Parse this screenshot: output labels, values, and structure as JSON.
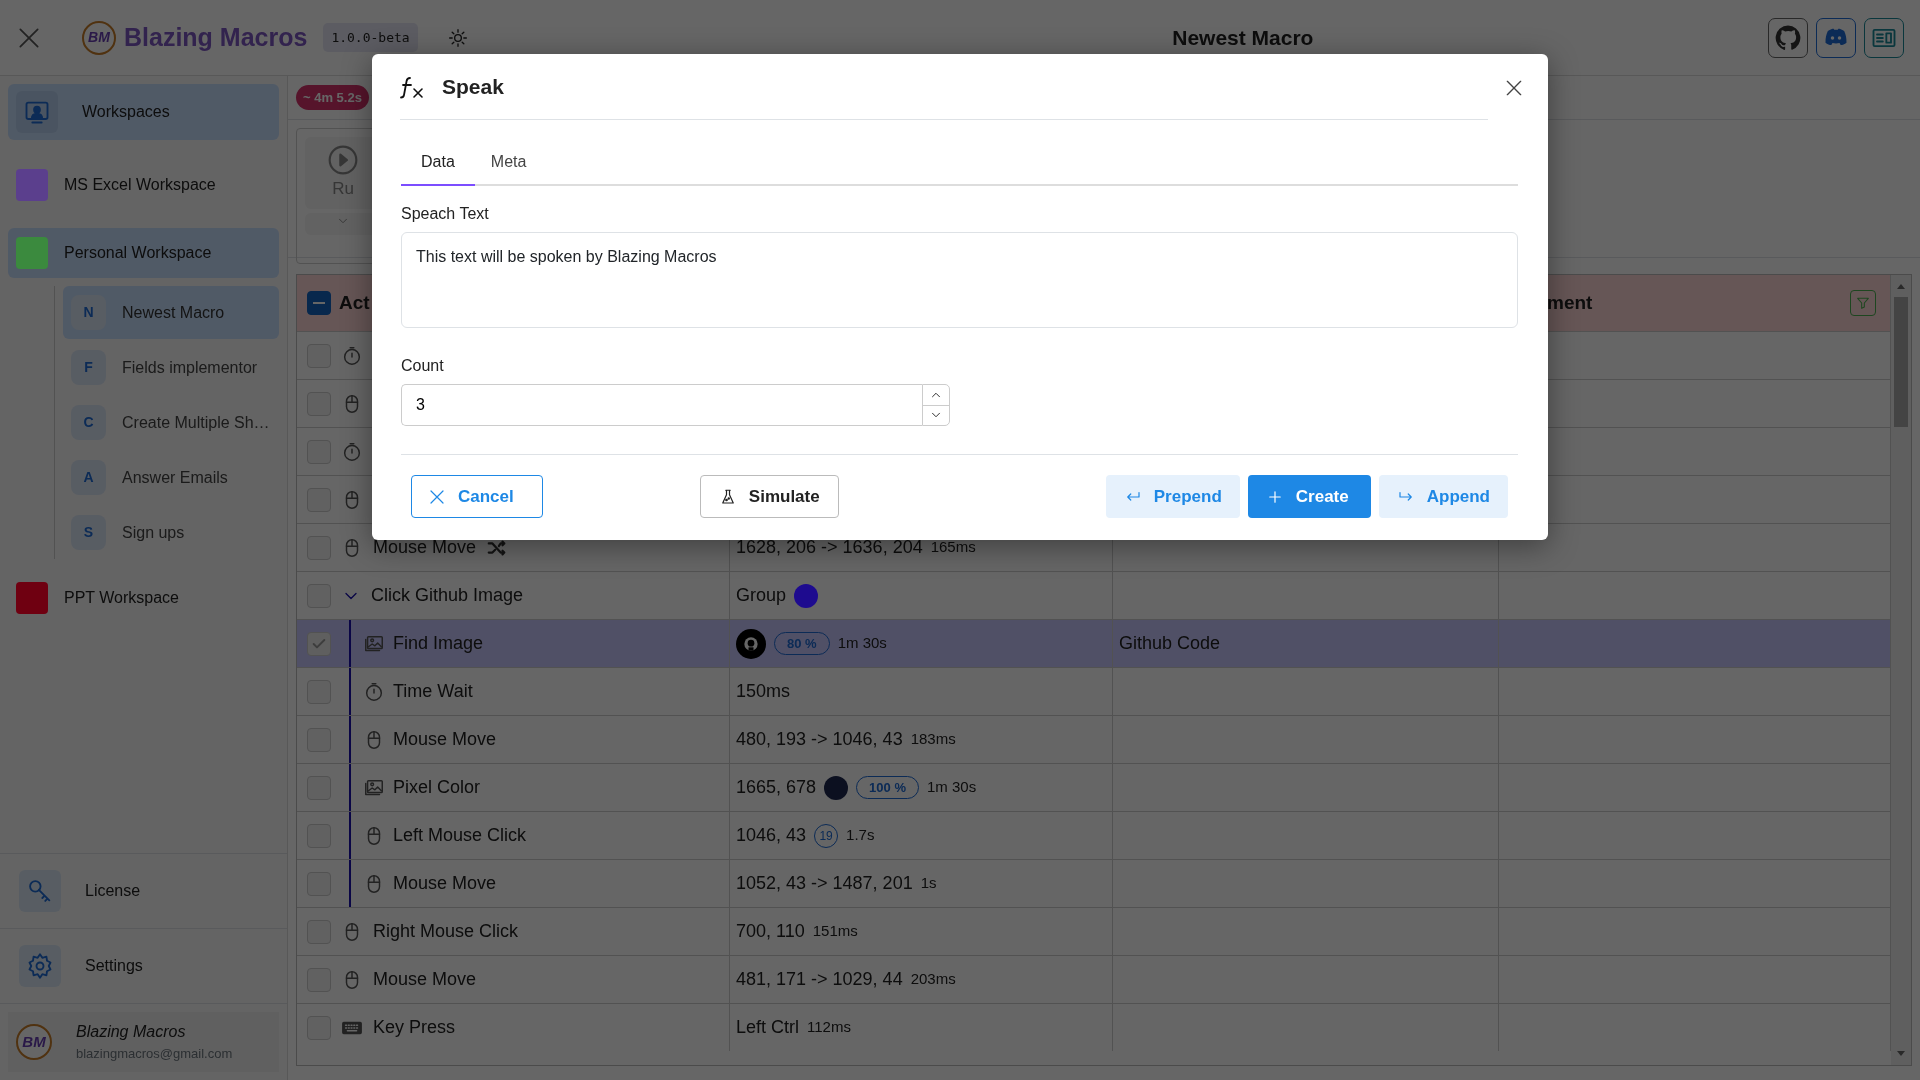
{
  "header": {
    "logo_text": "BM",
    "app_name": "Blazing Macros",
    "version": "1.0.0-beta",
    "page_title": "Newest Macro"
  },
  "sidebar": {
    "workspaces_label": "Workspaces",
    "workspaces": [
      {
        "name": "MS Excel Workspace",
        "color": "#5b3f8d",
        "selected": false
      },
      {
        "name": "Personal Workspace",
        "color": "#3b8a3e",
        "selected": true,
        "macros": [
          {
            "letter": "N",
            "name": "Newest Macro",
            "selected": true
          },
          {
            "letter": "F",
            "name": "Fields implementor",
            "selected": false
          },
          {
            "letter": "C",
            "name": "Create Multiple Sh…",
            "selected": false
          },
          {
            "letter": "A",
            "name": "Answer Emails",
            "selected": false
          },
          {
            "letter": "S",
            "name": "Sign ups",
            "selected": false
          }
        ]
      },
      {
        "name": "PPT Workspace",
        "color": "#6f0011",
        "selected": false
      }
    ],
    "footer_items": [
      {
        "kind": "license",
        "label": "License"
      },
      {
        "kind": "settings",
        "label": "Settings"
      }
    ],
    "user": {
      "logo_text": "BM",
      "name": "Blazing Macros",
      "email": "blazingmacros@gmail.com"
    }
  },
  "run_panel": {
    "duration": "~ 4m 5.2s",
    "run_label": "Ru"
  },
  "table": {
    "header": {
      "indeterminate": true,
      "column_1": "Act",
      "column_4": "ment"
    },
    "rows": [
      {
        "kind": "timer",
        "checked": false,
        "selected": false
      },
      {
        "kind": "mouse",
        "checked": false,
        "selected": false
      },
      {
        "kind": "timer",
        "checked": false,
        "selected": false
      },
      {
        "kind": "mouse",
        "checked": false,
        "selected": false
      },
      {
        "kind": "mouse",
        "name": "Mouse Move",
        "random": true,
        "value": "1628, 206 -> 1636, 204",
        "duration": "165ms",
        "checked": false,
        "selected": false
      },
      {
        "kind": "group",
        "name": "Click Github Image",
        "expanded": true,
        "value": "Group",
        "color": "#1e0b8f",
        "checked": false,
        "selected": false,
        "children": [
          {
            "kind": "image",
            "name": "Find Image",
            "preview": true,
            "confidence": "80 %",
            "duration": "1m 30s",
            "comment": "Github Code",
            "checked": true,
            "selected": true
          },
          {
            "kind": "timer",
            "name": "Time Wait",
            "value": "150ms",
            "checked": false,
            "selected": false
          },
          {
            "kind": "mouse",
            "name": "Mouse Move",
            "value": "480, 193 -> 1046, 43",
            "duration": "183ms",
            "checked": false,
            "selected": false
          },
          {
            "kind": "image",
            "name": "Pixel Color",
            "value": "1665, 678",
            "color": "#0c1020",
            "confidence": "100 %",
            "duration": "1m 30s",
            "checked": false,
            "selected": false
          },
          {
            "kind": "mouse",
            "name": "Left Mouse Click",
            "value": "1046, 43",
            "count": "19",
            "duration": "1.7s",
            "checked": false,
            "selected": false
          },
          {
            "kind": "mouse",
            "name": "Mouse Move",
            "value": "1052, 43 -> 1487, 201",
            "duration": "1s",
            "checked": false,
            "selected": false
          }
        ]
      },
      {
        "kind": "mouse",
        "name": "Right Mouse Click",
        "value": "700, 110",
        "duration": "151ms",
        "checked": false,
        "selected": false
      },
      {
        "kind": "mouse",
        "name": "Mouse Move",
        "value": "481, 171 -> 1029, 44",
        "duration": "203ms",
        "checked": false,
        "selected": false
      },
      {
        "kind": "keyboard",
        "name": "Key Press",
        "value": "Left Ctrl",
        "duration": "112ms",
        "checked": false,
        "selected": false
      }
    ]
  },
  "dialog": {
    "title": "Speak",
    "tabs": [
      {
        "label": "Data",
        "selected": true
      },
      {
        "label": "Meta",
        "selected": false
      }
    ],
    "fields": [
      {
        "kind": "textarea",
        "label": "Speach Text",
        "value": "This text will be spoken by Blazing Macros"
      },
      {
        "kind": "number",
        "label": "Count",
        "value": "3"
      }
    ],
    "buttons": [
      {
        "kind": "cancel",
        "label": "Cancel"
      },
      {
        "kind": "simulate",
        "label": "Simulate"
      },
      {
        "kind": "prepend",
        "label": "Prepend"
      },
      {
        "kind": "create",
        "label": "Create"
      },
      {
        "kind": "append",
        "label": "Append"
      }
    ]
  }
}
